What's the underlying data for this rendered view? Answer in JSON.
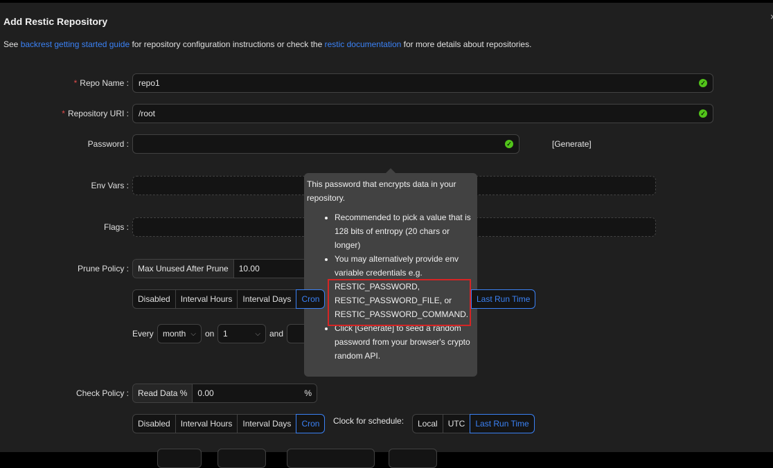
{
  "dialog": {
    "title": "Add Restic Repository",
    "intro_prefix": "See ",
    "link_guide": "backrest getting started guide",
    "intro_middle": " for repository configuration instructions or check the ",
    "link_docs": "restic documentation",
    "intro_suffix": " for more details about repositories."
  },
  "form": {
    "repo_name": {
      "label": "Repo Name",
      "value": "repo1"
    },
    "repo_uri": {
      "label": "Repository URI",
      "value": "/root"
    },
    "password": {
      "label": "Password",
      "value": "",
      "generate": "[Generate]"
    },
    "env_vars": {
      "label": "Env Vars"
    },
    "flags": {
      "label": "Flags"
    },
    "prune": {
      "label": "Prune Policy",
      "addon": "Max Unused After Prune",
      "value": "10.00",
      "schedule_options": [
        "Disabled",
        "Interval Hours",
        "Interval Days",
        "Cron"
      ],
      "schedule_selected": "Cron",
      "clock_selected": "Last Run Time",
      "every": "Every",
      "period": "month",
      "on": "on",
      "day": "1",
      "and": "and"
    },
    "check": {
      "label": "Check Policy",
      "addon": "Read Data %",
      "value": "0.00",
      "suffix": "%",
      "schedule_options": [
        "Disabled",
        "Interval Hours",
        "Interval Days",
        "Cron"
      ],
      "schedule_selected": "Cron",
      "clock_label": "Clock for schedule:",
      "clock_options": [
        "Local",
        "UTC",
        "Last Run Time"
      ],
      "clock_selected": "Last Run Time"
    }
  },
  "tooltip": {
    "intro": "This password that encrypts data in your repository.",
    "items": [
      "Recommended to pick a value that is 128 bits of entropy (20 chars or longer)",
      "You may alternatively provide env variable credentials e.g.",
      "RESTIC_PASSWORD,",
      "RESTIC_PASSWORD_FILE, or",
      "RESTIC_PASSWORD_COMMAND.",
      "Click [Generate] to seed a random password from your browser's crypto random API."
    ]
  },
  "colors": {
    "accent": "#3b82f6",
    "success": "#52c41a",
    "required": "#e14b4b",
    "highlight": "#d62424"
  }
}
